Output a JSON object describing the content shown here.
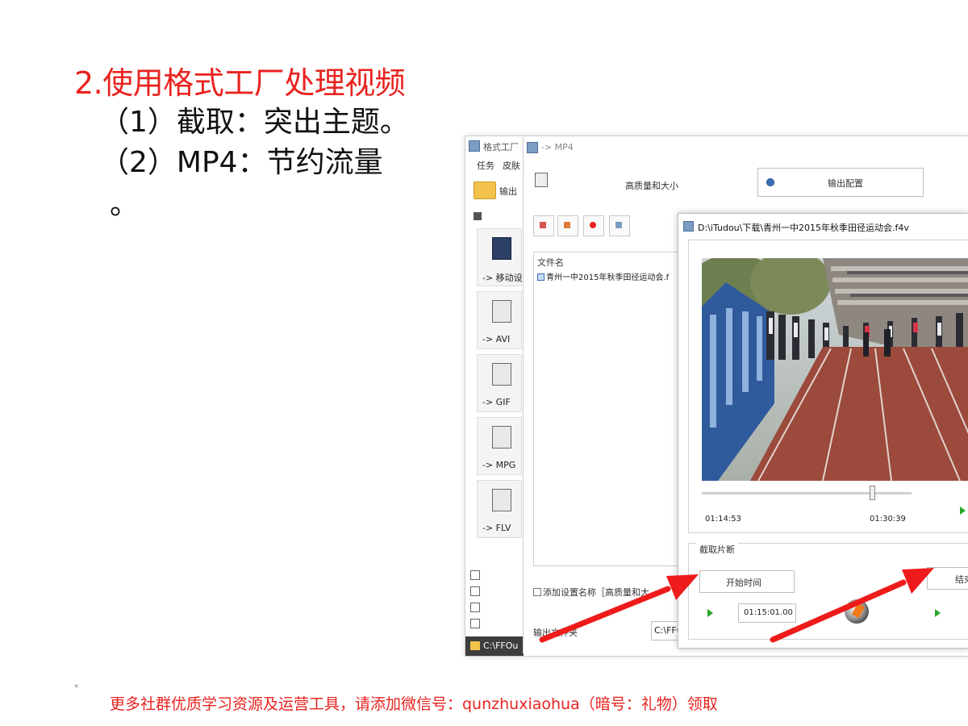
{
  "slide": {
    "title": "2.使用格式工厂处理视频",
    "line1": "（1）截取：突出主题。",
    "line2": "（2）MP4：节约流量",
    "line3": "。",
    "footer_mark": "*",
    "footer": "更多社群优质学习资源及运营工具，请添加微信号：qunzhuxiaohua（暗号：礼物）领取"
  },
  "app": {
    "title": "格式工厂",
    "menu": [
      "任务",
      "皮肤"
    ],
    "output_folder_button": "输出",
    "sidebar": [
      {
        "label": "-> 移动设",
        "icon": "mobile-device-icon"
      },
      {
        "label": "-> AVI",
        "icon": "avi-file-icon"
      },
      {
        "label": "-> GIF",
        "icon": "gif-file-icon"
      },
      {
        "label": "-> MPG",
        "icon": "mpg-file-icon"
      },
      {
        "label": "-> FLV",
        "icon": "flv-file-icon"
      }
    ],
    "status_path": "C:\\FFOu"
  },
  "mp4_dialog": {
    "title": "-> MP4",
    "quality_label": "高质量和大小",
    "output_config_label": "输出配置",
    "file_list_header": "文件名",
    "file_name": "青州一中2015年秋季田径运动会.f",
    "add_setting_label": "添加设置名称［高质量和大",
    "output_folder_label": "输出文件夹",
    "output_path": "C:\\FFO"
  },
  "clip_dialog": {
    "title": "D:\\iTudou\\下载\\青州一中2015年秋季田径运动会.f4v",
    "time_current": "01:14:53",
    "time_position": "01:30:39",
    "segment_label": "截取片断",
    "start_button": "开始时间",
    "end_button": "结束时间",
    "start_time_value": "01:15:01.00"
  },
  "colors": {
    "title_red": "#e8231f",
    "arrow_red": "#ee1b1b",
    "play_green": "#2aa52a"
  }
}
